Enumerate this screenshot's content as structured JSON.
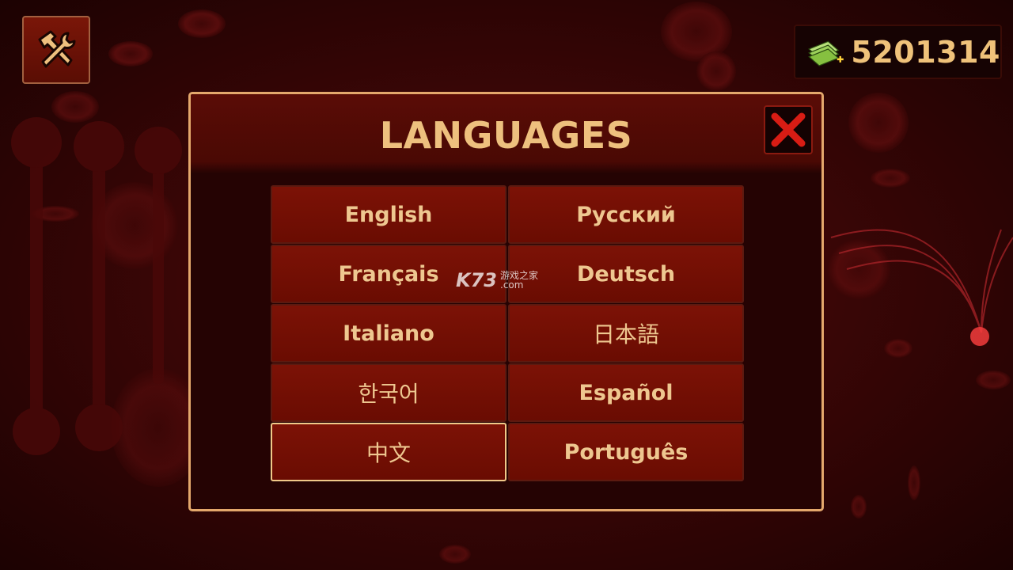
{
  "header": {
    "tools_icon": "hammer-wrench-icon",
    "money": {
      "icon": "cash-plus-icon",
      "value": "5201314"
    }
  },
  "dialog": {
    "title": "LANGUAGES",
    "close_icon": "close-x-icon",
    "languages": [
      {
        "label": "English",
        "selected": false
      },
      {
        "label": "Русский",
        "selected": false
      },
      {
        "label": "Français",
        "selected": false
      },
      {
        "label": "Deutsch",
        "selected": false
      },
      {
        "label": "Italiano",
        "selected": false
      },
      {
        "label": "日本語",
        "selected": false
      },
      {
        "label": "한국어",
        "selected": false
      },
      {
        "label": "Español",
        "selected": false
      },
      {
        "label": "中文",
        "selected": true
      },
      {
        "label": "Português",
        "selected": false
      }
    ]
  },
  "watermark": {
    "main": "K73",
    "line1": "游戏之家",
    "line2": ".com"
  },
  "colors": {
    "accent": "#eec07e",
    "button_bg": "#7c1206",
    "border_gold": "#e4a86c",
    "close_red": "#d81c14"
  }
}
